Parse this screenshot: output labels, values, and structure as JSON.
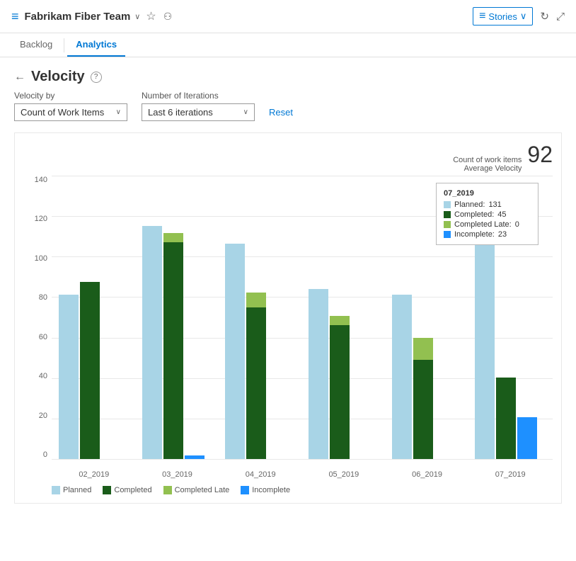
{
  "header": {
    "icon": "≡",
    "title": "Fabrikam Fiber Team",
    "chevron": "∨",
    "star_icon": "☆",
    "team_icon": "⚇",
    "stories_label": "Stories",
    "stories_chevron": "∨",
    "refresh_icon": "↻",
    "expand_icon": "⤢"
  },
  "nav": {
    "tabs": [
      {
        "id": "backlog",
        "label": "Backlog",
        "active": false
      },
      {
        "id": "analytics",
        "label": "Analytics",
        "active": true
      }
    ]
  },
  "page": {
    "back_icon": "←",
    "title": "Velocity",
    "help_icon": "?",
    "velocity_by_label": "Velocity by",
    "velocity_by_value": "Count of Work Items",
    "iterations_label": "Number of Iterations",
    "iterations_value": "Last 6 iterations",
    "reset_label": "Reset"
  },
  "chart": {
    "metric_label1": "Count of work items",
    "metric_label2": "Average Velocity",
    "avg_velocity": "92",
    "y_labels": [
      "140",
      "120",
      "100",
      "80",
      "60",
      "40",
      "20",
      "0"
    ],
    "bars": [
      {
        "label": "02_2019",
        "planned": 91,
        "completed": 98,
        "completed_late": 0,
        "incomplete": 0
      },
      {
        "label": "03_2019",
        "planned": 129,
        "completed": 120,
        "completed_late": 5,
        "incomplete": 2
      },
      {
        "label": "04_2019",
        "planned": 119,
        "completed": 84,
        "completed_late": 8,
        "incomplete": 0
      },
      {
        "label": "05_2019",
        "planned": 94,
        "completed": 74,
        "completed_late": 5,
        "incomplete": 0
      },
      {
        "label": "06_2019",
        "planned": 91,
        "completed": 55,
        "completed_late": 12,
        "incomplete": 0
      },
      {
        "label": "07_2019",
        "planned": 130,
        "completed": 45,
        "completed_late": 0,
        "incomplete": 23
      }
    ],
    "tooltip": {
      "title": "07_2019",
      "planned_label": "Planned:",
      "planned_value": "131",
      "completed_label": "Completed:",
      "completed_value": "45",
      "completed_late_label": "Completed Late:",
      "completed_late_value": "0",
      "incomplete_label": "Incomplete:",
      "incomplete_value": "23"
    },
    "legend": [
      {
        "id": "planned",
        "label": "Planned",
        "color": "#a8d4e6"
      },
      {
        "id": "completed",
        "label": "Completed",
        "color": "#1a5c1a"
      },
      {
        "id": "completed-late",
        "label": "Completed Late",
        "color": "#92c050"
      },
      {
        "id": "incomplete",
        "label": "Incomplete",
        "color": "#1e90ff"
      }
    ]
  }
}
